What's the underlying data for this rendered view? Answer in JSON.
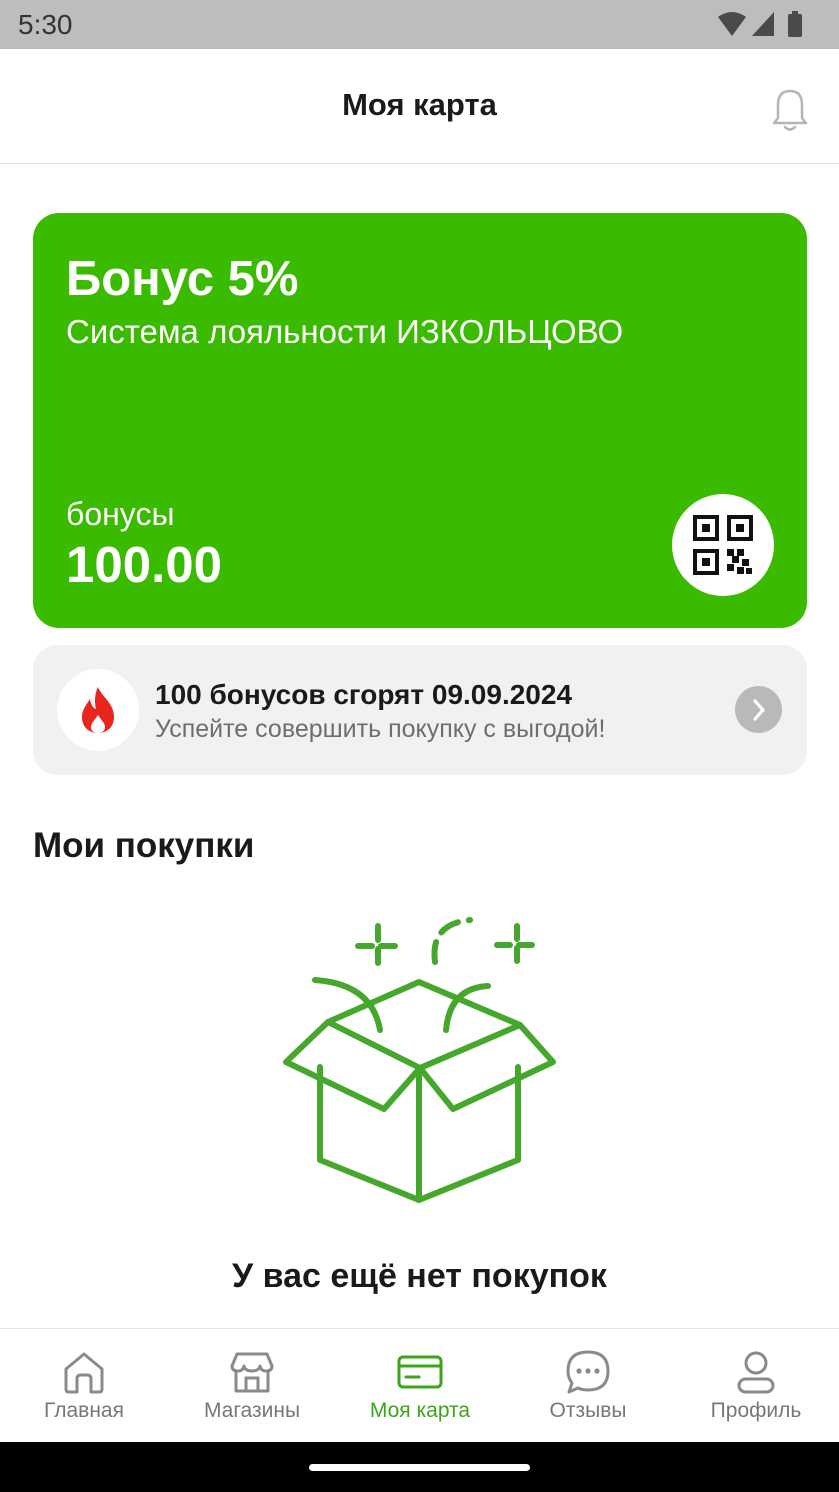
{
  "status_bar": {
    "time": "5:30"
  },
  "header": {
    "title": "Моя карта"
  },
  "card": {
    "title": "Бонус 5%",
    "subtitle": "Система лояльности ИЗКОЛЬЦОВО",
    "bonus_label": "бонусы",
    "bonus_value": "100.00",
    "color": "#3bbb00"
  },
  "expiry_banner": {
    "title": "100 бонусов сгорят 09.09.2024",
    "text": "Успейте совершить покупку с выгодой!",
    "fire_color": "#e8251e"
  },
  "purchases": {
    "section_title": "Мои покупки",
    "empty_text": "У вас ещё нет покупок",
    "illustration_color": "#45a82d"
  },
  "bottom_nav": {
    "items": [
      {
        "label": "Главная",
        "icon": "home-icon"
      },
      {
        "label": "Магазины",
        "icon": "store-icon"
      },
      {
        "label": "Моя карта",
        "icon": "card-icon",
        "active": true
      },
      {
        "label": "Отзывы",
        "icon": "chat-icon"
      },
      {
        "label": "Профиль",
        "icon": "profile-icon"
      }
    ],
    "active_color": "#3aa61a"
  }
}
